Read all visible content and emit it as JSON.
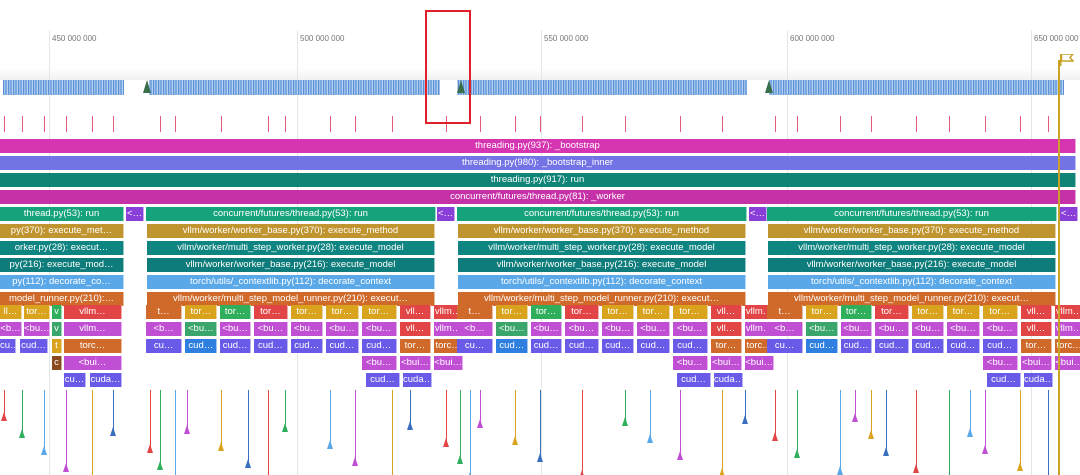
{
  "timeline": {
    "tick_labels": [
      "450 000 000",
      "500 000 000",
      "550 000 000",
      "600 000 000",
      "650 000 000"
    ],
    "accent_highlight_color": "#e0202a",
    "playhead_color": "#c9a227"
  },
  "flame": {
    "full_rows": [
      {
        "label": "threading.py(937): _bootstrap",
        "color": "#d535b0"
      },
      {
        "label": "threading.py(980): _bootstrap_inner",
        "color": "#7373e6"
      },
      {
        "label": "threading.py(917): run",
        "color": "#118478"
      },
      {
        "label": "concurrent/futures/thread.py(81): _worker",
        "color": "#c532a8"
      }
    ],
    "block_rows": [
      {
        "labels": [
          "thread.py(53): run",
          "concurrent/futures/thread.py(53): run",
          "concurrent/futures/thread.py(53): run",
          "concurrent/futures/thread.py(53): run"
        ],
        "color": "#16a37b"
      },
      {
        "labels": [
          "py(370): execute_met…",
          "vllm/worker/worker_base.py(370): execute_method",
          "vllm/worker/worker_base.py(370): execute_method",
          "vllm/worker/worker_base.py(370): execute_method"
        ],
        "color": "#c0942f"
      },
      {
        "labels": [
          "orker.py(28): execut…",
          "vllm/worker/multi_step_worker.py(28): execute_model",
          "vllm/worker/multi_step_worker.py(28): execute_model",
          "vllm/worker/multi_step_worker.py(28): execute_model"
        ],
        "color": "#0f8582"
      },
      {
        "labels": [
          "py(216): execute_mod…",
          "vllm/worker/worker_base.py(216): execute_model",
          "vllm/worker/worker_base.py(216): execute_model",
          "vllm/worker/worker_base.py(216): execute_model"
        ],
        "color": "#0d7c7a"
      },
      {
        "labels": [
          "py(112): decorate_co…",
          "torch/utils/_contextlib.py(112): decorate_context",
          "torch/utils/_contextlib.py(112): decorate_context",
          "torch/utils/_contextlib.py(112): decorate_context"
        ],
        "color": "#5aa8e8"
      },
      {
        "labels": [
          "model_runner.py(210):…",
          "vllm/worker/multi_step_model_runner.py(210): execut…",
          "vllm/worker/multi_step_model_runner.py(210): execut…",
          "vllm/worker/multi_step_model_runner.py(210): execut…"
        ],
        "color": "#cf6a2a"
      }
    ],
    "small_label": "<…"
  }
}
